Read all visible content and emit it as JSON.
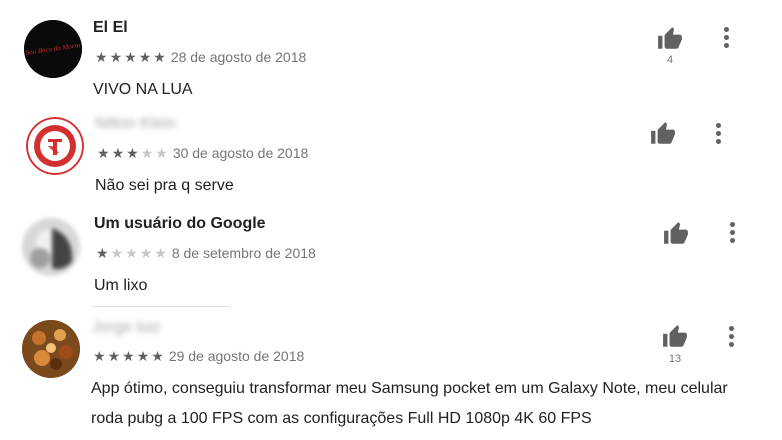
{
  "reviews": [
    {
      "author": "El El",
      "stars": [
        "★",
        "★",
        "★",
        "★",
        "★"
      ],
      "rating": 5,
      "date": "28 de agosto de 2018",
      "text": "VIVO NA LUA",
      "helpful_count": "4",
      "avatar_text": "Sou Baco do Morro"
    },
    {
      "author": "Nilton Klein",
      "stars": [
        "★",
        "★",
        "★",
        "★",
        "★"
      ],
      "rating": 3,
      "date": "30 de agosto de 2018",
      "text": "Não sei pra q serve",
      "helpful_count": ""
    },
    {
      "author": "Um usuário do Google",
      "stars": [
        "★",
        "★",
        "★",
        "★",
        "★"
      ],
      "rating": 1,
      "date": "8 de setembro de 2018",
      "text": "Um lixo",
      "helpful_count": ""
    },
    {
      "author": "Jorge luiz",
      "stars": [
        "★",
        "★",
        "★",
        "★",
        "★"
      ],
      "rating": 5,
      "date": "29 de agosto de 2018",
      "text_line1": "App ótimo, conseguiu transformar meu Samsung pocket em um Galaxy Note, meu celular",
      "text_line2": "roda pubg a 100 FPS com as configurações Full HD 1080p 4K 60 FPS",
      "helpful_count": "13"
    }
  ],
  "colors": {
    "star_on": "#616161",
    "star_off": "#c8c8c8",
    "icon": "#616161",
    "inter_red": "#d32f2f"
  },
  "icons": {
    "helpful": "thumb-up-icon",
    "menu": "more-vert-icon"
  }
}
